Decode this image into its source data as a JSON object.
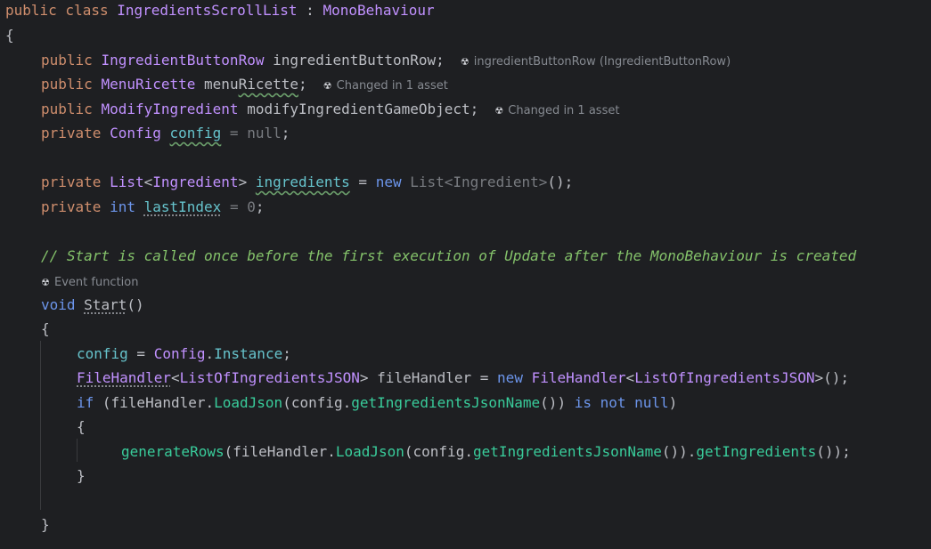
{
  "code": {
    "l1": {
      "kw": "public class ",
      "name": "IngredientsScrollList",
      "sep": " : ",
      "base": "MonoBehaviour"
    },
    "l2": {
      "brace": "{"
    },
    "l3": {
      "kw": "public ",
      "type": "IngredientButtonRow",
      "name": " ingredientButtonRow;",
      "hint": "ingredientButtonRow (IngredientButtonRow)"
    },
    "l4": {
      "kw": "public ",
      "type": "MenuRicette",
      "name_a": " menu",
      "name_b": "Ricette",
      "semi": ";",
      "hint": "Changed in 1 asset"
    },
    "l5": {
      "kw": "public ",
      "type": "ModifyIngredient",
      "name": " modifyIngredientGameObject;",
      "hint": "Changed in 1 asset"
    },
    "l6": {
      "kw": "private ",
      "type": "Config",
      "sp": " ",
      "field": "config",
      "eq": " = ",
      "val": "null",
      "semi": ";"
    },
    "l8": {
      "kw": "private ",
      "type1": "List",
      "lt": "<",
      "type2": "Ingredient",
      "gt": "> ",
      "field": "ingredients",
      "eq": " = ",
      "new": "new ",
      "rest": "List<Ingredient>",
      "end": "();"
    },
    "l9": {
      "kw": "private ",
      "int": "int",
      "sp": " ",
      "field": "lastIndex",
      "eq": " = ",
      "val": "0",
      "semi": ";"
    },
    "l11": {
      "comment": "// Start is called once before the first execution of Update after the MonoBehaviour is created"
    },
    "l12": {
      "hint": "Event function"
    },
    "l13": {
      "kw": "void ",
      "name": "Start",
      "paren": "()"
    },
    "l14": {
      "brace": "{"
    },
    "l15": {
      "field": "config",
      "eq": " = ",
      "type": "Config",
      "dot": ".",
      "prop": "Instance",
      "semi": ";"
    },
    "l16": {
      "type1": "FileHandler",
      "lt": "<",
      "type2": "ListOfIngredientsJSON",
      "gt": "> ",
      "var": "fileHandler",
      "eq": " = ",
      "new": "new ",
      "type3": "FileHandler",
      "lt2": "<",
      "type4": "ListOfIngredientsJSON",
      "end": ">();"
    },
    "l17": {
      "kw": "if",
      "p1": " (fileHandler.",
      "m1": "LoadJson",
      "p2": "(config.",
      "m2": "getIngredientsJsonName",
      "p3": "()) ",
      "is": "is not null",
      "p4": ")"
    },
    "l18": {
      "brace": "{"
    },
    "l19": {
      "m1": "generateRows",
      "p1": "(fileHandler.",
      "m2": "LoadJson",
      "p2": "(config.",
      "m3": "getIngredientsJsonName",
      "p3": "()).",
      "m4": "getIngredients",
      "p4": "());"
    },
    "l20": {
      "brace": "}"
    },
    "l22": {
      "brace": "}"
    }
  },
  "colors": {
    "background": "#1e1f22",
    "keyword": "#cf8e6d",
    "type": "#c191ff",
    "field": "#66c3cc",
    "method": "#39cc9b",
    "comment": "#84c26a"
  },
  "icons": {
    "unity_hint": "unity-icon"
  }
}
